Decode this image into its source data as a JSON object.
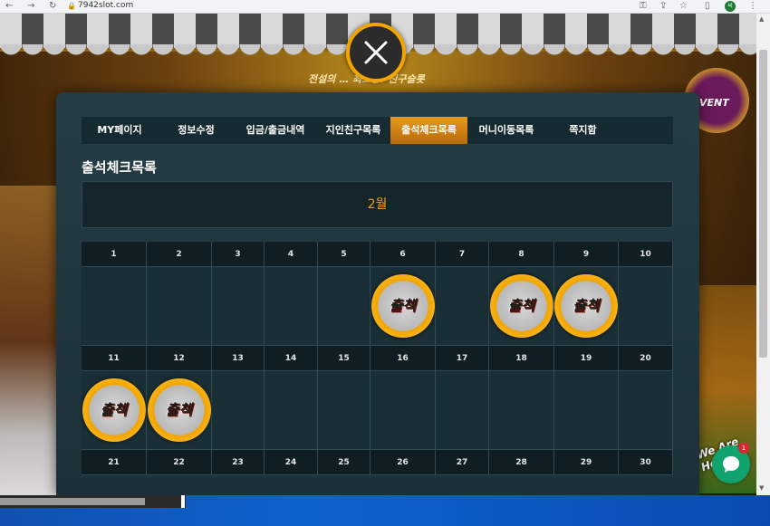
{
  "browser": {
    "url": "7942slot.com",
    "profile_initial": "씨"
  },
  "background": {
    "banner_text": "전설의 …  최고봉! 친구슬롯",
    "event_label": "VENT",
    "chat_promo": "We Are Here"
  },
  "modal": {
    "tabs": [
      {
        "label": "MY페이지",
        "active": false
      },
      {
        "label": "정보수정",
        "active": false
      },
      {
        "label": "입금/출금내역",
        "active": false
      },
      {
        "label": "지인친구목록",
        "active": false
      },
      {
        "label": "출석체크목록",
        "active": true
      },
      {
        "label": "머니이동목록",
        "active": false
      },
      {
        "label": "쪽지함",
        "active": false
      }
    ],
    "section_title": "출석체크목록",
    "month": "2월",
    "calendar": {
      "stamp_label": "출첵",
      "weeks": [
        {
          "days": [
            "1",
            "2",
            "3",
            "4",
            "5",
            "6",
            "7",
            "8",
            "9",
            "10"
          ],
          "checked": [
            false,
            false,
            false,
            false,
            false,
            true,
            false,
            true,
            true,
            false
          ]
        },
        {
          "days": [
            "11",
            "12",
            "13",
            "14",
            "15",
            "16",
            "17",
            "18",
            "19",
            "20"
          ],
          "checked": [
            true,
            true,
            false,
            false,
            false,
            false,
            false,
            false,
            false,
            false
          ]
        },
        {
          "days": [
            "21",
            "22",
            "23",
            "24",
            "25",
            "26",
            "27",
            "28",
            "29",
            "30"
          ],
          "checked": [
            false,
            false,
            false,
            false,
            false,
            false,
            false,
            false,
            false,
            false
          ]
        }
      ]
    }
  },
  "chat": {
    "badge_count": "1"
  },
  "colors": {
    "accent": "#f2a400",
    "modal_bg": "#1f353d",
    "month_text": "#f0a020",
    "chat_green": "#10a36e"
  }
}
